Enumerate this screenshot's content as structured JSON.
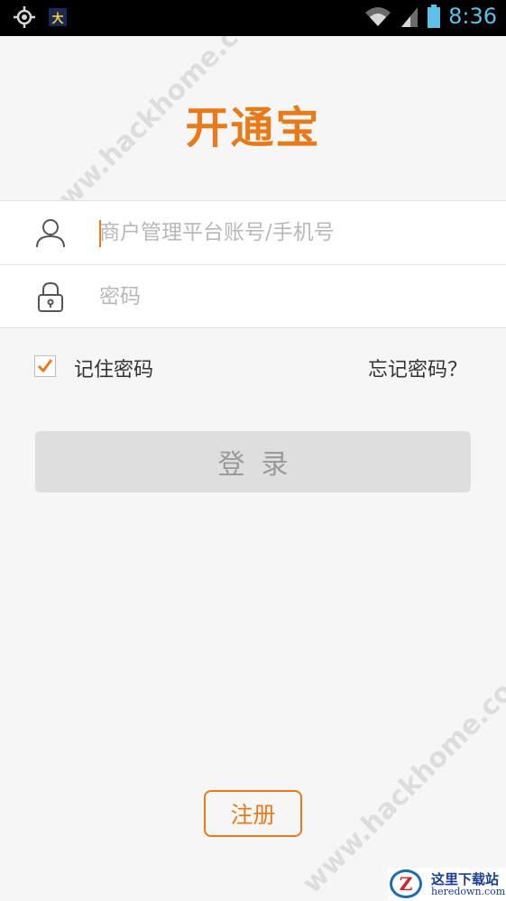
{
  "status_bar": {
    "time": "8:36",
    "app_badge": "大",
    "icons": [
      "location-icon",
      "app-notification-icon",
      "wifi-icon",
      "signal-icon",
      "battery-icon"
    ],
    "color": "#5cc0e8"
  },
  "app": {
    "logo_text": "开通宝",
    "brand_color": "#e87a1a"
  },
  "form": {
    "account_placeholder": "商户管理平台账号/手机号",
    "account_value": "",
    "password_placeholder": "密码",
    "password_value": "",
    "icons": [
      "user-icon",
      "lock-icon"
    ]
  },
  "remember": {
    "label": "记住密码",
    "checked": true
  },
  "forgot": {
    "label": "忘记密码？"
  },
  "login": {
    "label": "登录"
  },
  "register": {
    "label": "注册"
  },
  "watermarks": {
    "text": "www.hackhome.com",
    "site_title": "这里下载站",
    "site_url": "heredown.com",
    "site_logo": "Z"
  }
}
